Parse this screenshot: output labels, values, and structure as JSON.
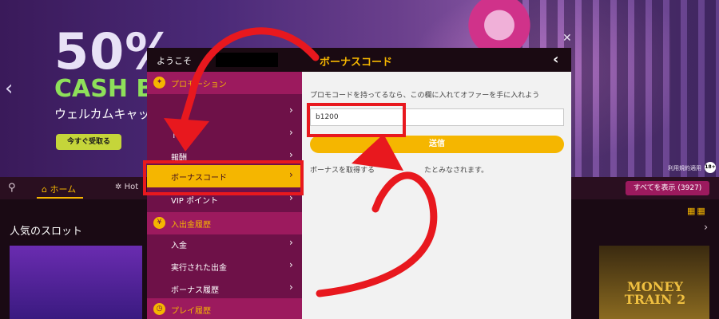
{
  "banner": {
    "headline": "50%",
    "cash": "CASH B",
    "subtitle": "ウェルカムキャッ",
    "cta": "今すぐ受取る",
    "rules": "利用規約適用",
    "age": "18+"
  },
  "navbar": {
    "home": "ホーム",
    "hot": "Hot",
    "view_all": "すべてを表示 (3927)"
  },
  "section_title": "人気のスロット",
  "game_right_title": "MONEY TRAIN 2",
  "modal": {
    "welcome": "ようこそ",
    "title": "ボーナスコード",
    "sidebar": [
      {
        "label": "プロモーション",
        "type": "section"
      },
      {
        "label": "",
        "type": "item"
      },
      {
        "label": "トー",
        "type": "item"
      },
      {
        "label": "報酬",
        "type": "item"
      },
      {
        "label": "ボーナスコード",
        "type": "item",
        "active": true
      },
      {
        "label": "VIP ポイント",
        "type": "item"
      },
      {
        "label": "入出金履歴",
        "type": "section"
      },
      {
        "label": "入金",
        "type": "item"
      },
      {
        "label": "実行された出金",
        "type": "item"
      },
      {
        "label": "ボーナス履歴",
        "type": "item"
      },
      {
        "label": "プレイ履歴",
        "type": "section"
      }
    ],
    "hint": "プロモコードを持ってるなら、この欄に入れてオファーを手に入れよう",
    "input_value": "b1200",
    "submit": "送信",
    "note": "ボーナスを取得する",
    "note_tail": "たとみなされます。"
  },
  "colors": {
    "accent": "#f5b600",
    "sidebar": "#6e1148",
    "annotation": "#e8181e"
  }
}
